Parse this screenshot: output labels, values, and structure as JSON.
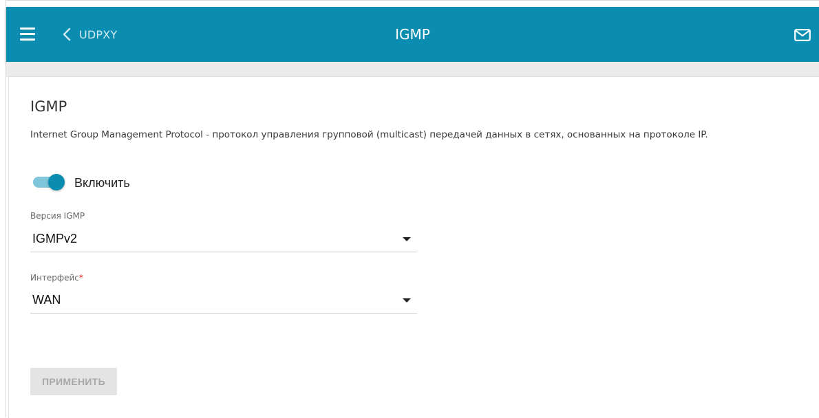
{
  "header": {
    "title": "IGMP",
    "back_label": "UDPXY",
    "background": "#0a8db0"
  },
  "icons": {
    "menu": "hamburger-menu-icon",
    "back": "chevron-left-icon",
    "mail": "envelope-icon",
    "dropdown": "triangle-down-icon"
  },
  "section": {
    "title": "IGMP",
    "description": "Internet Group Management Protocol - протокол управления групповой (multicast) передачей данных в сетях, основанных на протоколе IP."
  },
  "enable_toggle": {
    "label": "Включить",
    "checked": true,
    "accent": "#0a8db0"
  },
  "igmp_version": {
    "label": "Версия IGMP",
    "value": "IGMPv2"
  },
  "interface": {
    "label": "Интерфейс",
    "required_mark": "*",
    "value": "WAN"
  },
  "apply_button": {
    "label": "ПРИМЕНИТЬ",
    "disabled": true
  }
}
